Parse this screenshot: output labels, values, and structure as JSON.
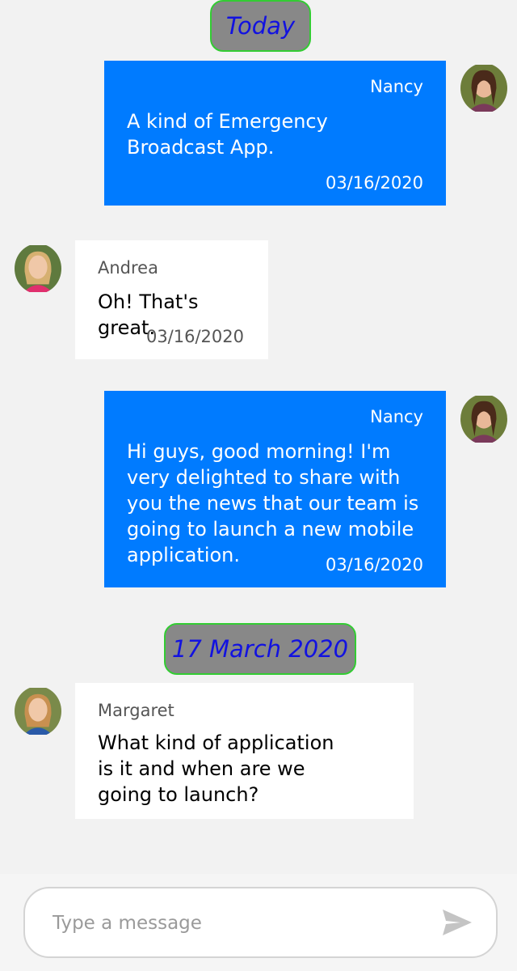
{
  "chat": {
    "date_dividers": [
      "Today",
      "17 March 2020"
    ],
    "messages": [
      {
        "sender": "Nancy",
        "text": "A kind of Emergency Broadcast App.",
        "time": "03/16/2020"
      },
      {
        "sender": "Andrea",
        "text": "Oh! That's great.",
        "time": "03/16/2020"
      },
      {
        "sender": "Nancy",
        "text": "Hi guys, good morning! I'm very delighted to share with you the news that our team is going to launch a new mobile application.",
        "time": "03/16/2020"
      },
      {
        "sender": "Margaret",
        "text": "What kind of application is it and when are we going to launch?"
      }
    ]
  },
  "composer": {
    "placeholder": "Type a message",
    "send_icon": "send-icon"
  },
  "colors": {
    "outgoing_bubble": "#007bff",
    "incoming_bubble": "#ffffff",
    "background": "#f2f2f2",
    "date_chip_fill": "#888888",
    "date_chip_border": "#33cc33",
    "date_chip_text": "#1212e0"
  }
}
